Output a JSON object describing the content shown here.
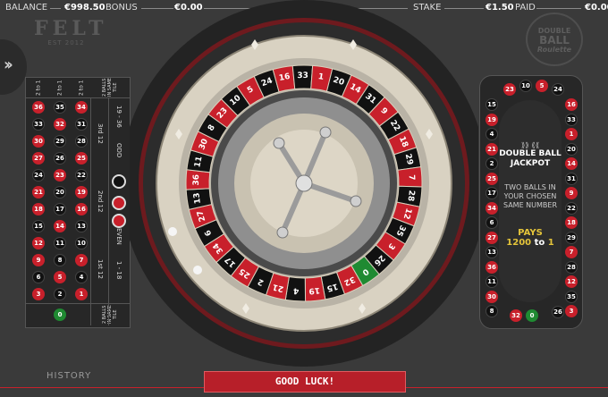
{
  "header": {
    "balance_label": "BALANCE",
    "balance_value": "€998.50",
    "bonus_label": "BONUS",
    "bonus_value": "€0.00",
    "stake_label": "STAKE",
    "stake_value": "€1.50",
    "paid_label": "PAID",
    "paid_value": "€0.00"
  },
  "brand": {
    "felt_word": "FELT",
    "felt_est": "EST 2012",
    "game_logo_top": "DOUBLE",
    "game_logo_mid": "BALL",
    "game_logo_bottom": "Roulette"
  },
  "board": {
    "column_bets": [
      "2 to 1",
      "2 to 1",
      "2 to 1"
    ],
    "rows": [
      [
        {
          "n": "36",
          "c": "red"
        },
        {
          "n": "35",
          "c": "black"
        },
        {
          "n": "34",
          "c": "red"
        }
      ],
      [
        {
          "n": "33",
          "c": "black"
        },
        {
          "n": "32",
          "c": "red"
        },
        {
          "n": "31",
          "c": "black"
        }
      ],
      [
        {
          "n": "30",
          "c": "red"
        },
        {
          "n": "29",
          "c": "black"
        },
        {
          "n": "28",
          "c": "black"
        }
      ],
      [
        {
          "n": "27",
          "c": "red"
        },
        {
          "n": "26",
          "c": "black"
        },
        {
          "n": "25",
          "c": "red"
        }
      ],
      [
        {
          "n": "24",
          "c": "black"
        },
        {
          "n": "23",
          "c": "red"
        },
        {
          "n": "22",
          "c": "black"
        }
      ],
      [
        {
          "n": "21",
          "c": "red"
        },
        {
          "n": "20",
          "c": "black"
        },
        {
          "n": "19",
          "c": "red"
        }
      ],
      [
        {
          "n": "18",
          "c": "red"
        },
        {
          "n": "17",
          "c": "black"
        },
        {
          "n": "16",
          "c": "red"
        }
      ],
      [
        {
          "n": "15",
          "c": "black"
        },
        {
          "n": "14",
          "c": "red"
        },
        {
          "n": "13",
          "c": "black"
        }
      ],
      [
        {
          "n": "12",
          "c": "red"
        },
        {
          "n": "11",
          "c": "black"
        },
        {
          "n": "10",
          "c": "black"
        }
      ],
      [
        {
          "n": "9",
          "c": "red"
        },
        {
          "n": "8",
          "c": "black"
        },
        {
          "n": "7",
          "c": "red"
        }
      ],
      [
        {
          "n": "6",
          "c": "black"
        },
        {
          "n": "5",
          "c": "red"
        },
        {
          "n": "4",
          "c": "black"
        }
      ],
      [
        {
          "n": "3",
          "c": "red"
        },
        {
          "n": "2",
          "c": "black"
        },
        {
          "n": "1",
          "c": "red"
        }
      ]
    ],
    "zero": "0",
    "dozens": [
      "3rd 12",
      "2nd 12",
      "1st 12"
    ],
    "outside": [
      "19 - 36",
      "ODD",
      "EVEN",
      "1 - 18"
    ],
    "special_top": "2 BALLS IN SAME TILE",
    "special_bottom": "2 BALLS IN SAME TILE"
  },
  "wheel": {
    "numbers": [
      "0",
      "32",
      "15",
      "19",
      "4",
      "21",
      "2",
      "25",
      "17",
      "34",
      "6",
      "27",
      "13",
      "36",
      "11",
      "30",
      "8",
      "23",
      "10",
      "5",
      "24",
      "16",
      "33",
      "1",
      "20",
      "14",
      "31",
      "9",
      "22",
      "18",
      "29",
      "7",
      "28",
      "12",
      "35",
      "3",
      "26"
    ],
    "colors": {
      "red": "#c8202b",
      "black": "#111111",
      "green": "#1f8a32"
    }
  },
  "racetrack": {
    "numbers_top": [
      "23",
      "10",
      "5",
      "24"
    ],
    "numbers_right": [
      "16",
      "33",
      "1",
      "20",
      "14",
      "31",
      "9",
      "22",
      "18",
      "29",
      "7",
      "28",
      "12",
      "35",
      "3"
    ],
    "numbers_bottom": [
      "26",
      "0",
      "32"
    ],
    "numbers_left": [
      "15",
      "19",
      "4",
      "21",
      "2",
      "25",
      "17",
      "34",
      "6",
      "27",
      "13",
      "36",
      "11",
      "30",
      "8"
    ]
  },
  "jackpot": {
    "title_1": "DOUBLE BALL",
    "title_2": "JACKPOT",
    "desc_1": "TWO BALLS IN",
    "desc_2": "YOUR CHOSEN",
    "desc_3": "SAME NUMBER",
    "pays_label": "PAYS",
    "odds_left": "1200",
    "odds_to": "to",
    "odds_right": "1"
  },
  "footer": {
    "history_label": "HISTORY",
    "status_banner": "GOOD LUCK!"
  }
}
